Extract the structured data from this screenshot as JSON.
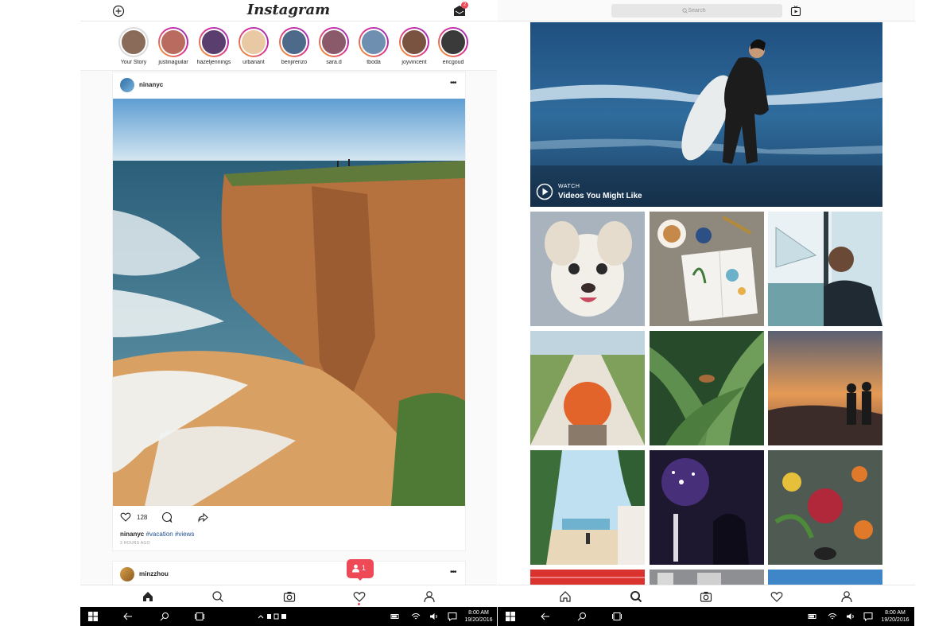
{
  "left": {
    "header": {
      "logo": "Instagram",
      "inbox_badge": "2"
    },
    "stories": [
      {
        "name": "Your Story",
        "self": true,
        "color": "#8a6b5a"
      },
      {
        "name": "justinaguilar",
        "color": "#b96b5f"
      },
      {
        "name": "hazeljennings",
        "color": "#5a3e6e"
      },
      {
        "name": "urbanant",
        "color": "#e8c9a4"
      },
      {
        "name": "benjirenzo",
        "color": "#4e6a8a"
      },
      {
        "name": "sara.d",
        "color": "#8a5a6a"
      },
      {
        "name": "tboda",
        "color": "#6f8fb0"
      },
      {
        "name": "joyvincent",
        "color": "#7a5240"
      },
      {
        "name": "ericgoud",
        "color": "#3a3a3a"
      }
    ],
    "post": {
      "username": "ninanyc",
      "likes": "128",
      "caption_user": "ninanyc",
      "caption_tags": "#vacation #views",
      "time": "3 HOURS AGO"
    },
    "post2": {
      "username": "minzzhou"
    },
    "notification": {
      "count": "1"
    },
    "taskbar": {
      "time": "8:00 AM",
      "date": "19/20/2016"
    }
  },
  "right": {
    "search": {
      "placeholder": "Search"
    },
    "video": {
      "label_small": "WATCH",
      "label_title": "Videos You Might Like"
    },
    "taskbar": {
      "time": "8:00 AM",
      "date": "19/20/2016"
    }
  },
  "colors": {
    "accent": "#ed4956",
    "link": "#1f4f8f",
    "border": "#e6e6e6"
  }
}
